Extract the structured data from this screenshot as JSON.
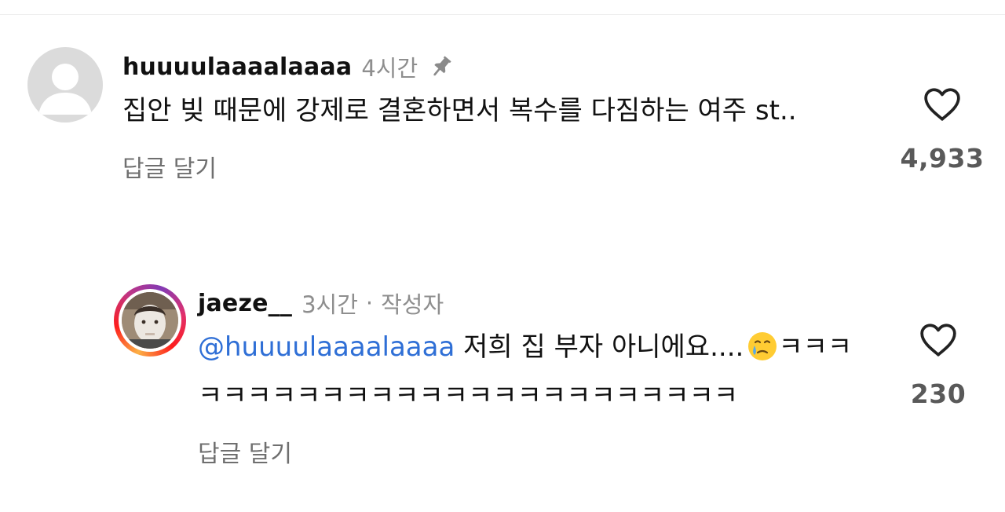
{
  "comments": [
    {
      "username": "huuuulaaaalaaaa",
      "time": "4시간",
      "pinned": true,
      "text": "집안 빚 때문에 강제로 결혼하면서 복수를 다짐하는 여주 st..",
      "reply_label": "답글 달기",
      "likes": "4,933",
      "avatar": "default-avatar-icon"
    }
  ],
  "reply": {
    "username": "jaeze__",
    "time": "3시간",
    "separator": "·",
    "author_badge": "작성자",
    "mention": "@huuuulaaaalaaaa",
    "text": " 저희 집 부자 아니에요....",
    "text_tail": "ㅋㅋㅋㅋㅋㅋㅋㅋㅋㅋㅋㅋㅋㅋㅋㅋㅋㅋㅋㅋㅋㅋㅋㅋㅋ",
    "emoji": "face-holding-back-tears-icon",
    "reply_label": "답글 달기",
    "likes": "230"
  },
  "icons": {
    "heart": "heart-outline-icon",
    "pin": "pin-icon"
  },
  "colors": {
    "mention": "#2f6fd6",
    "secondary_text": "#8e8e8e",
    "story_ring_start": "#fcb045",
    "story_ring_end": "#c13584"
  }
}
